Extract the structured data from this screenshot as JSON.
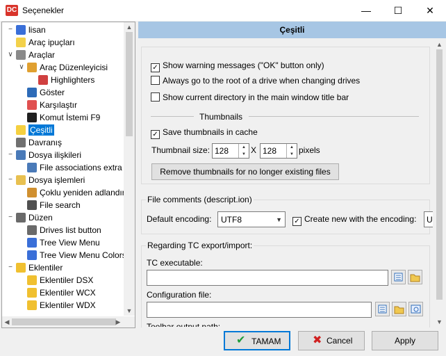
{
  "window": {
    "title": "Seçenekler",
    "app_icon_text": "DC"
  },
  "tree": {
    "items": [
      {
        "label": "lisan",
        "icon": "flag-icon",
        "color": "#3a6fd8"
      },
      {
        "label": "Araç ipuçları",
        "icon": "lightbulb-icon",
        "color": "#f3d14a"
      },
      {
        "label": "Araçlar",
        "icon": "tools-icon",
        "color": "#8a8a8a"
      },
      {
        "label": "Araç Düzenleyicisi",
        "icon": "editor-icon",
        "color": "#e0a030"
      },
      {
        "label": "Highlighters",
        "icon": "document-icon",
        "color": "#d04040"
      },
      {
        "label": "Göster",
        "icon": "book-icon",
        "color": "#2d6bb8"
      },
      {
        "label": "Karşılaştır",
        "icon": "compare-icon",
        "color": "#e05050"
      },
      {
        "label": "Komut İstemi F9",
        "icon": "terminal-icon",
        "color": "#202020"
      },
      {
        "label": "Çeşitli",
        "icon": "smiley-icon",
        "color": "#f5d040"
      },
      {
        "label": "Davranış",
        "icon": "window-icon",
        "color": "#707070"
      },
      {
        "label": "Dosya ilişkileri",
        "icon": "file-assoc-icon",
        "color": "#4a7ab8"
      },
      {
        "label": "File associations extra",
        "icon": "file-assoc-extra-icon",
        "color": "#4a7ab8"
      },
      {
        "label": "Dosya işlemleri",
        "icon": "folder-icon",
        "color": "#e8c050"
      },
      {
        "label": "Çoklu yeniden adlandır",
        "icon": "rename-icon",
        "color": "#d09030"
      },
      {
        "label": "File search",
        "icon": "binoculars-icon",
        "color": "#505050"
      },
      {
        "label": "Düzen",
        "icon": "layout-icon",
        "color": "#6a6a6a"
      },
      {
        "label": "Drives list button",
        "icon": "drives-icon",
        "color": "#6a6a6a"
      },
      {
        "label": "Tree View Menu",
        "icon": "tree-menu-icon",
        "color": "#3a6fd8"
      },
      {
        "label": "Tree View Menu Colors",
        "icon": "tree-colors-icon",
        "color": "#3a6fd8"
      },
      {
        "label": "Eklentiler",
        "icon": "puzzle-icon",
        "color": "#f0c030"
      },
      {
        "label": "Eklentiler DSX",
        "icon": "puzzle-icon",
        "color": "#f0c030"
      },
      {
        "label": "Eklentiler WCX",
        "icon": "puzzle-icon",
        "color": "#f0c030"
      },
      {
        "label": "Eklentiler WDX",
        "icon": "puzzle-icon",
        "color": "#f0c030"
      }
    ]
  },
  "panel": {
    "header": "Çeşitli",
    "general": {
      "show_warning": "Show warning messages (\"OK\" button only)",
      "go_root": "Always go to the root of a drive when changing drives",
      "show_dir_title": "Show current directory in the main window title bar"
    },
    "thumbnails": {
      "title": "Thumbnails",
      "save_cache": "Save thumbnails in cache",
      "size_label": "Thumbnail size:",
      "width": "128",
      "x": "X",
      "height": "128",
      "pixels": "pixels",
      "remove_button": "Remove thumbnails for no longer existing files"
    },
    "comments": {
      "title": "File comments (descript.ion)",
      "encoding_label": "Default encoding:",
      "encoding_value": "UTF8",
      "create_new": "Create new with the encoding:",
      "create_new_value": "U"
    },
    "export": {
      "title": "Regarding TC export/import:",
      "exe_label": "TC executable:",
      "config_label": "Configuration file:",
      "toolbar_label": "Toolbar output path:"
    }
  },
  "buttons": {
    "ok": "TAMAM",
    "cancel": "Cancel",
    "apply": "Apply"
  }
}
